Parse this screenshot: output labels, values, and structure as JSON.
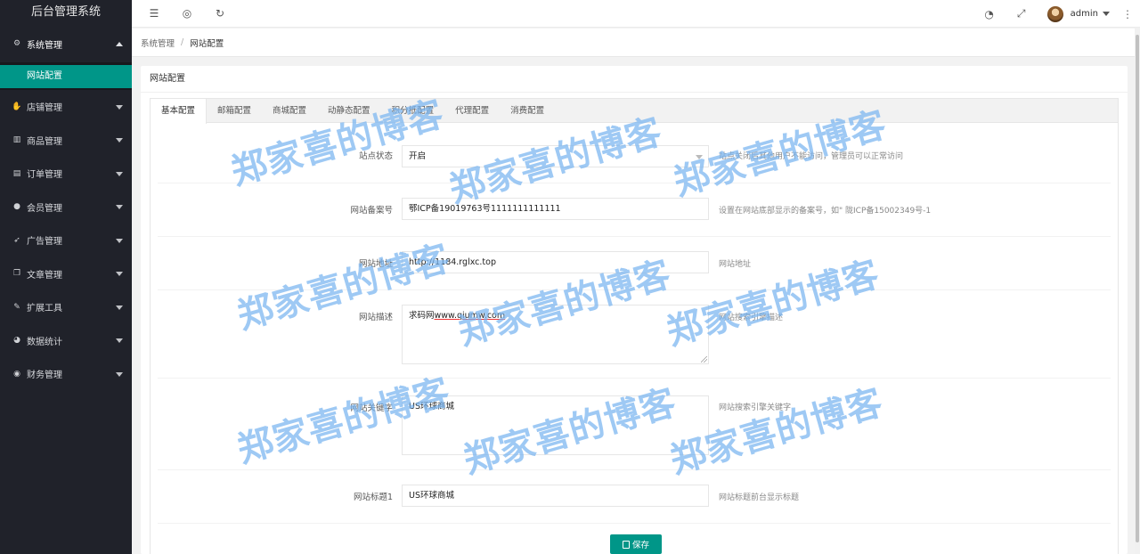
{
  "app": {
    "title": "后台管理系统"
  },
  "sidebar": {
    "items": [
      {
        "label": "系统管理",
        "icon": "gear-icon",
        "open": true
      },
      {
        "label": "店铺管理",
        "icon": "hand-icon"
      },
      {
        "label": "商品管理",
        "icon": "bar-chart-icon"
      },
      {
        "label": "订单管理",
        "icon": "calendar-icon"
      },
      {
        "label": "会员管理",
        "icon": "users-icon"
      },
      {
        "label": "广告管理",
        "icon": "rocket-icon"
      },
      {
        "label": "文章管理",
        "icon": "copy-icon"
      },
      {
        "label": "扩展工具",
        "icon": "wrench-icon"
      },
      {
        "label": "数据统计",
        "icon": "pie-chart-icon"
      },
      {
        "label": "财务管理",
        "icon": "circle-dot-icon"
      }
    ],
    "submenu": {
      "active_label": "网站配置"
    }
  },
  "topbar": {
    "user": "admin"
  },
  "breadcrumb": {
    "parent": "系统管理",
    "separator": "/",
    "current": "网站配置"
  },
  "card": {
    "title": "网站配置"
  },
  "tabs": [
    {
      "label": "基本配置",
      "active": true
    },
    {
      "label": "邮箱配置"
    },
    {
      "label": "商城配置"
    },
    {
      "label": "动静态配置"
    },
    {
      "label": "积分抵配置"
    },
    {
      "label": "代理配置"
    },
    {
      "label": "消费配置"
    }
  ],
  "form": {
    "site_status": {
      "label": "站点状态",
      "value": "开启",
      "hint": "站点关闭后其他用户不能访问，管理员可以正常访问"
    },
    "icp": {
      "label": "网站备案号",
      "value": "鄂ICP备19019763号1111111111111",
      "hint": "设置在网站底部显示的备案号，如\" 陇ICP备15002349号-1"
    },
    "url": {
      "label": "网站地址",
      "value": "http://1184.rglxc.top",
      "hint": "网站地址"
    },
    "description": {
      "label": "网站描述",
      "value_prefix": "求码网",
      "value_link": "www.qiumw.com",
      "hint": "网站搜索引擎描述"
    },
    "keywords": {
      "label": "网站关键字",
      "value": "US环球商城",
      "hint": "网站搜索引擎关键字"
    },
    "title1": {
      "label": "网站标题1",
      "value": "US环球商城",
      "hint": "网站标题前台显示标题"
    }
  },
  "save_label": "保存",
  "watermark": "郑家喜的博客"
}
